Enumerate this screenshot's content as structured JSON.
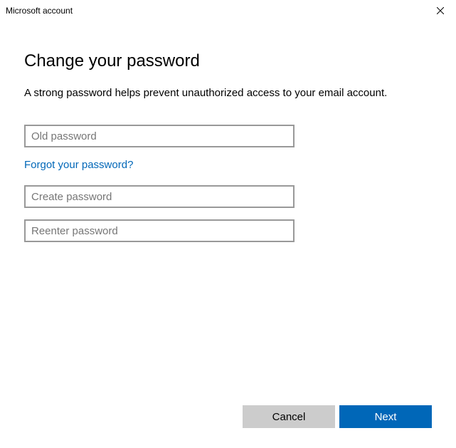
{
  "window": {
    "title": "Microsoft account"
  },
  "page": {
    "heading": "Change your password",
    "description": "A strong password helps prevent unauthorized access to your email account."
  },
  "fields": {
    "old_password": {
      "placeholder": "Old password",
      "value": ""
    },
    "new_password": {
      "placeholder": "Create password",
      "value": ""
    },
    "confirm_password": {
      "placeholder": "Reenter password",
      "value": ""
    }
  },
  "links": {
    "forgot": "Forgot your password?"
  },
  "buttons": {
    "cancel": "Cancel",
    "next": "Next"
  }
}
